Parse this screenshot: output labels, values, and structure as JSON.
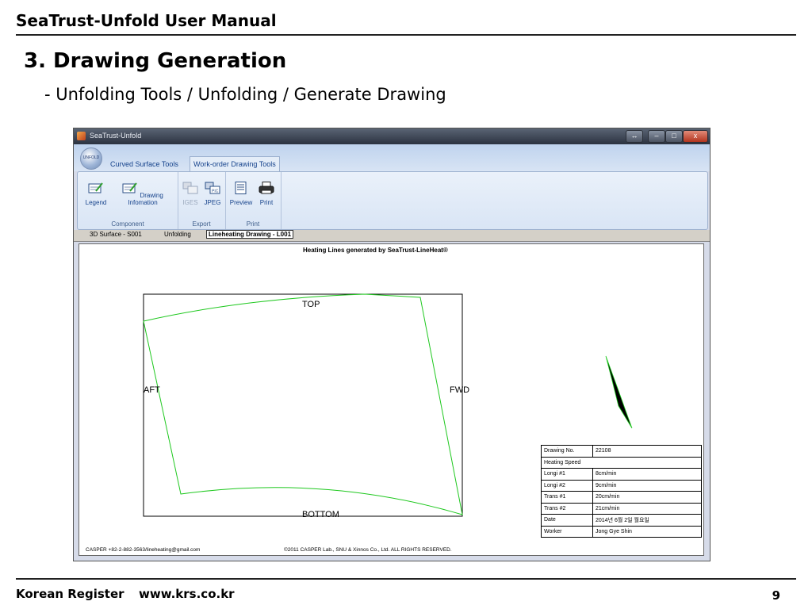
{
  "doc": {
    "header": "SeaTrust-Unfold User Manual",
    "section_title": "3. Drawing Generation",
    "section_path": "- Unfolding Tools / Unfolding / Generate Drawing",
    "footer_org": "Korean Register",
    "footer_url": "www.krs.co.kr",
    "page_number": "9"
  },
  "window": {
    "title": "SeaTrust-Unfold",
    "orb_label": "UNFOLD",
    "controls": {
      "restore": "↔",
      "minimize": "–",
      "maximize": "□",
      "close": "x"
    }
  },
  "ribbon": {
    "tabs": [
      {
        "label": "Curved Surface Tools",
        "active": false
      },
      {
        "label": "Work-order Drawing Tools",
        "active": true
      }
    ],
    "groups": [
      {
        "label": "Component",
        "buttons": [
          {
            "label": "Legend",
            "icon": "legend-icon"
          },
          {
            "label": "Drawing Infomation",
            "icon": "drawing-info-icon"
          }
        ]
      },
      {
        "label": "Export",
        "buttons": [
          {
            "label": "IGES",
            "icon": "iges-icon",
            "enabled": false
          },
          {
            "label": "JPEG",
            "icon": "jpeg-icon",
            "enabled": true
          }
        ]
      },
      {
        "label": "Print",
        "buttons": [
          {
            "label": "Preview",
            "icon": "preview-icon"
          },
          {
            "label": "Print",
            "icon": "printer-icon"
          }
        ]
      }
    ]
  },
  "doc_tabs": [
    {
      "label": "3D Surface - S001",
      "active": false
    },
    {
      "label": "Unfolding",
      "active": false
    },
    {
      "label": "Lineheating Drawing - L001",
      "active": true
    }
  ],
  "drawing": {
    "title": "Heating Lines generated by SeaTrust-LineHeat®",
    "labels": {
      "top": "TOP",
      "bottom": "BOTTOM",
      "aft": "AFT",
      "fwd": "FWD"
    },
    "line_color": "#00cc00",
    "contact": "CASPER +82-2-882-3563/lineheating@gmail.com",
    "copyright": "©2011 CASPER Lab., SNU & Xinnos Co., Ltd. ALL RIGHTS RESERVED.",
    "info": [
      {
        "key": "Drawing No.",
        "value": "22108"
      },
      {
        "key": "Heating Speed",
        "value": ""
      },
      {
        "key": "Longi #1",
        "value": "8cm/min"
      },
      {
        "key": "Longi #2",
        "value": "9cm/min"
      },
      {
        "key": "Trans #1",
        "value": "20cm/min"
      },
      {
        "key": "Trans #2",
        "value": "21cm/min"
      },
      {
        "key": "Date",
        "value": "2014년 6월 2일 월요일"
      },
      {
        "key": "Worker",
        "value": "Jong Gye Shin"
      }
    ]
  }
}
